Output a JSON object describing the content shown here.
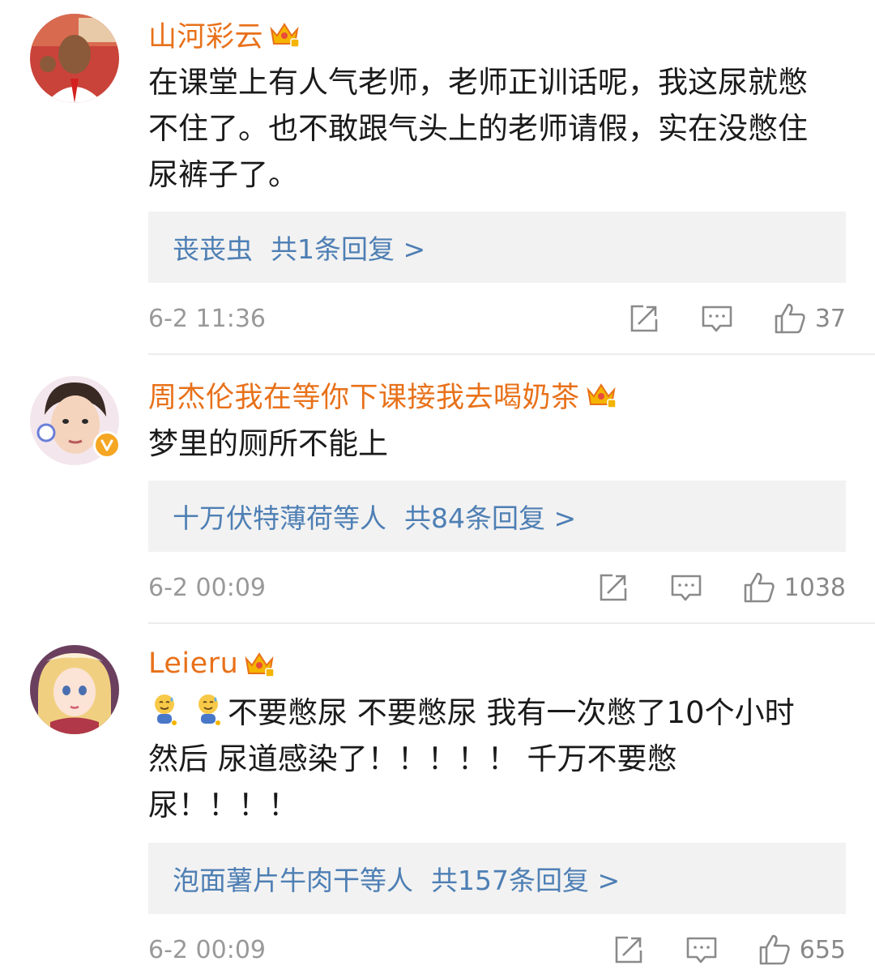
{
  "comments": [
    {
      "username": "山河彩云",
      "text_lines": [
        "在课堂上有人气老师，老师正训话呢，我这尿就憋",
        "不住了。也不敢跟气头上的老师请假，实在没憋住",
        "尿裤子了。"
      ],
      "reply_users": "丧丧虫",
      "reply_count": "共1条回复 >",
      "timestamp": "6-2 11:36",
      "likes": "37"
    },
    {
      "username": "周杰伦我在等你下课接我去喝奶茶",
      "text_lines": [
        "梦里的厕所不能上"
      ],
      "reply_users": "十万伏特薄荷等人",
      "reply_count": "共84条回复 >",
      "timestamp": "6-2 00:09",
      "likes": "1038"
    },
    {
      "username": "Leieru",
      "text_lines": [
        "不要憋尿 不要憋尿 我有一次憋了10个小时",
        "然后 尿道感染了！！！！！ 千万不要憋",
        "尿！！！！"
      ],
      "emoji_icons": [
        "sweat-smile-emoji",
        "sweat-smile-emoji"
      ],
      "reply_users": "泡面薯片牛肉干等人",
      "reply_count": "共157条回复 >",
      "timestamp": "6-2 00:09",
      "likes": "655"
    }
  ],
  "icons": {
    "crown": "vip-crown-icon",
    "share": "share-icon",
    "comment": "comment-icon",
    "like": "like-icon",
    "verified": "verified-badge-icon"
  },
  "colors": {
    "username": "#e8711a",
    "reply_link": "#4e7fb4",
    "body_text": "#1a1a1a",
    "meta": "#999999",
    "reply_bg": "#f2f2f2"
  }
}
